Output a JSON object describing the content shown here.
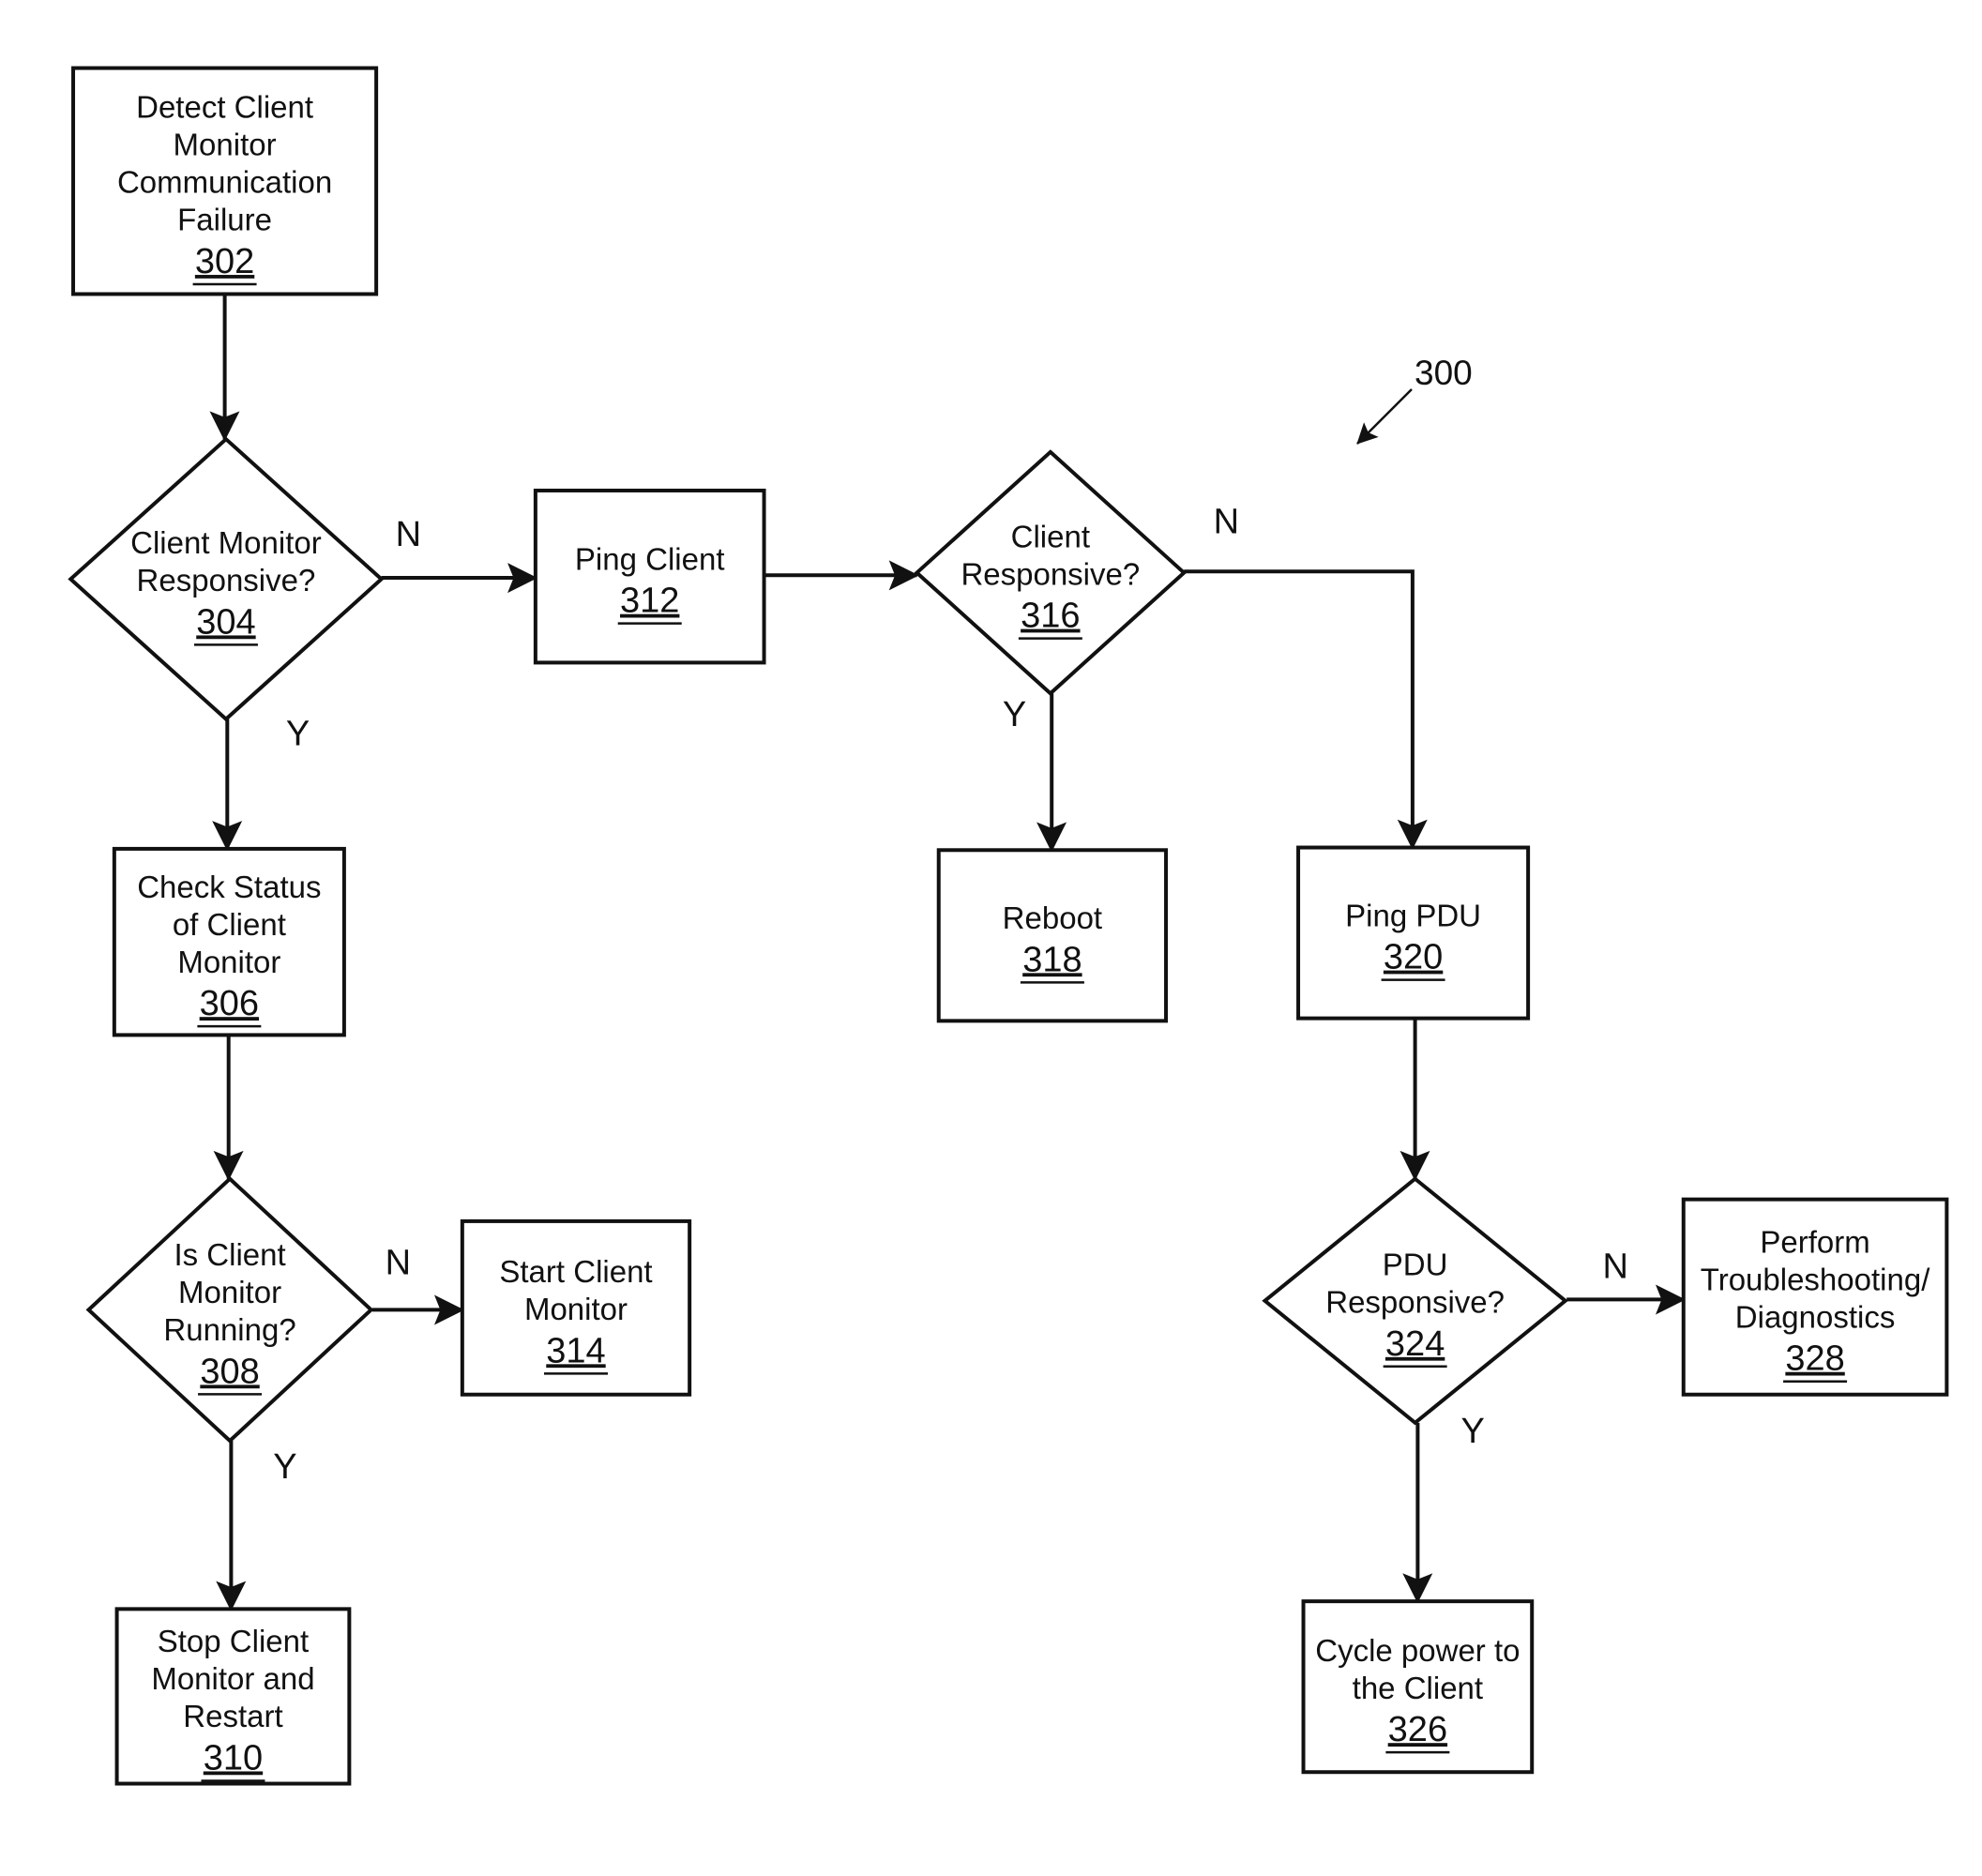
{
  "figure": {
    "reference_number": "300"
  },
  "nodes": [
    {
      "id": "302",
      "type": "process",
      "lines": [
        "Detect Client",
        "Monitor",
        "Communication",
        "Failure"
      ],
      "number": "302"
    },
    {
      "id": "304",
      "type": "decision",
      "lines": [
        "Client Monitor",
        "Responsive?"
      ],
      "number": "304"
    },
    {
      "id": "306",
      "type": "process",
      "lines": [
        "Check Status",
        "of Client",
        "Monitor"
      ],
      "number": "306"
    },
    {
      "id": "308",
      "type": "decision",
      "lines": [
        "Is Client",
        "Monitor",
        "Running?"
      ],
      "number": "308"
    },
    {
      "id": "310",
      "type": "process",
      "lines": [
        "Stop Client",
        "Monitor and",
        "Restart"
      ],
      "number": "310"
    },
    {
      "id": "312",
      "type": "process",
      "lines": [
        "Ping Client"
      ],
      "number": "312"
    },
    {
      "id": "314",
      "type": "process",
      "lines": [
        "Start Client",
        "Monitor"
      ],
      "number": "314"
    },
    {
      "id": "316",
      "type": "decision",
      "lines": [
        "Client",
        "Responsive?"
      ],
      "number": "316"
    },
    {
      "id": "318",
      "type": "process",
      "lines": [
        "Reboot"
      ],
      "number": "318"
    },
    {
      "id": "320",
      "type": "process",
      "lines": [
        "Ping PDU"
      ],
      "number": "320"
    },
    {
      "id": "324",
      "type": "decision",
      "lines": [
        "PDU",
        "Responsive?"
      ],
      "number": "324"
    },
    {
      "id": "326",
      "type": "process",
      "lines": [
        "Cycle power to",
        "the Client"
      ],
      "number": "326"
    },
    {
      "id": "328",
      "type": "process",
      "lines": [
        "Perform",
        "Troubleshooting/",
        "Diagnostics"
      ],
      "number": "328"
    }
  ],
  "edges": [
    {
      "from": "302",
      "to": "304",
      "label": ""
    },
    {
      "from": "304",
      "to": "312",
      "label": "N"
    },
    {
      "from": "304",
      "to": "306",
      "label": "Y"
    },
    {
      "from": "306",
      "to": "308",
      "label": ""
    },
    {
      "from": "308",
      "to": "314",
      "label": "N"
    },
    {
      "from": "308",
      "to": "310",
      "label": "Y"
    },
    {
      "from": "312",
      "to": "316",
      "label": ""
    },
    {
      "from": "316",
      "to": "318",
      "label": "Y"
    },
    {
      "from": "316",
      "to": "320",
      "label": "N"
    },
    {
      "from": "320",
      "to": "324",
      "label": ""
    },
    {
      "from": "324",
      "to": "328",
      "label": "N"
    },
    {
      "from": "324",
      "to": "326",
      "label": "Y"
    }
  ]
}
